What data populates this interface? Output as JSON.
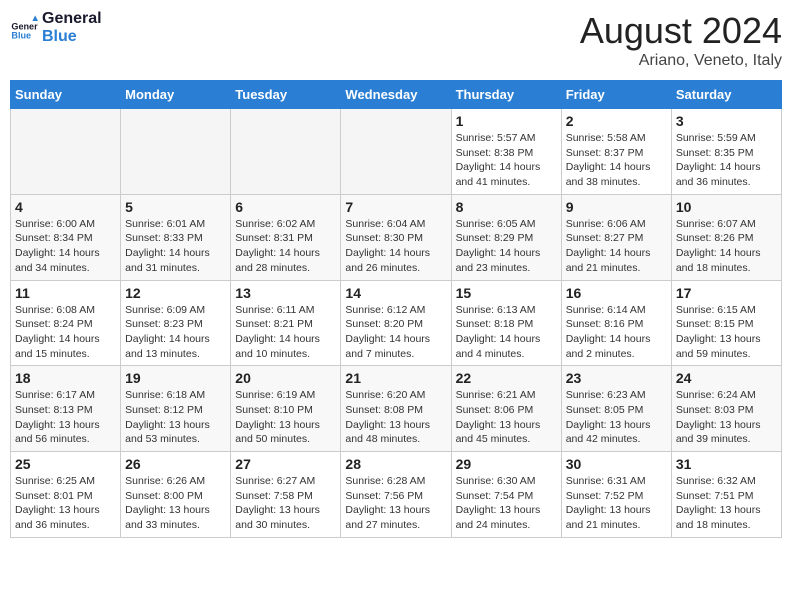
{
  "logo": {
    "line1": "General",
    "line2": "Blue"
  },
  "title": "August 2024",
  "location": "Ariano, Veneto, Italy",
  "weekdays": [
    "Sunday",
    "Monday",
    "Tuesday",
    "Wednesday",
    "Thursday",
    "Friday",
    "Saturday"
  ],
  "weeks": [
    [
      {
        "day": "",
        "empty": true
      },
      {
        "day": "",
        "empty": true
      },
      {
        "day": "",
        "empty": true
      },
      {
        "day": "",
        "empty": true
      },
      {
        "day": "1",
        "sunrise": "5:57 AM",
        "sunset": "8:38 PM",
        "daylight": "14 hours and 41 minutes."
      },
      {
        "day": "2",
        "sunrise": "5:58 AM",
        "sunset": "8:37 PM",
        "daylight": "14 hours and 38 minutes."
      },
      {
        "day": "3",
        "sunrise": "5:59 AM",
        "sunset": "8:35 PM",
        "daylight": "14 hours and 36 minutes."
      }
    ],
    [
      {
        "day": "4",
        "sunrise": "6:00 AM",
        "sunset": "8:34 PM",
        "daylight": "14 hours and 34 minutes."
      },
      {
        "day": "5",
        "sunrise": "6:01 AM",
        "sunset": "8:33 PM",
        "daylight": "14 hours and 31 minutes."
      },
      {
        "day": "6",
        "sunrise": "6:02 AM",
        "sunset": "8:31 PM",
        "daylight": "14 hours and 28 minutes."
      },
      {
        "day": "7",
        "sunrise": "6:04 AM",
        "sunset": "8:30 PM",
        "daylight": "14 hours and 26 minutes."
      },
      {
        "day": "8",
        "sunrise": "6:05 AM",
        "sunset": "8:29 PM",
        "daylight": "14 hours and 23 minutes."
      },
      {
        "day": "9",
        "sunrise": "6:06 AM",
        "sunset": "8:27 PM",
        "daylight": "14 hours and 21 minutes."
      },
      {
        "day": "10",
        "sunrise": "6:07 AM",
        "sunset": "8:26 PM",
        "daylight": "14 hours and 18 minutes."
      }
    ],
    [
      {
        "day": "11",
        "sunrise": "6:08 AM",
        "sunset": "8:24 PM",
        "daylight": "14 hours and 15 minutes."
      },
      {
        "day": "12",
        "sunrise": "6:09 AM",
        "sunset": "8:23 PM",
        "daylight": "14 hours and 13 minutes."
      },
      {
        "day": "13",
        "sunrise": "6:11 AM",
        "sunset": "8:21 PM",
        "daylight": "14 hours and 10 minutes."
      },
      {
        "day": "14",
        "sunrise": "6:12 AM",
        "sunset": "8:20 PM",
        "daylight": "14 hours and 7 minutes."
      },
      {
        "day": "15",
        "sunrise": "6:13 AM",
        "sunset": "8:18 PM",
        "daylight": "14 hours and 4 minutes."
      },
      {
        "day": "16",
        "sunrise": "6:14 AM",
        "sunset": "8:16 PM",
        "daylight": "14 hours and 2 minutes."
      },
      {
        "day": "17",
        "sunrise": "6:15 AM",
        "sunset": "8:15 PM",
        "daylight": "13 hours and 59 minutes."
      }
    ],
    [
      {
        "day": "18",
        "sunrise": "6:17 AM",
        "sunset": "8:13 PM",
        "daylight": "13 hours and 56 minutes."
      },
      {
        "day": "19",
        "sunrise": "6:18 AM",
        "sunset": "8:12 PM",
        "daylight": "13 hours and 53 minutes."
      },
      {
        "day": "20",
        "sunrise": "6:19 AM",
        "sunset": "8:10 PM",
        "daylight": "13 hours and 50 minutes."
      },
      {
        "day": "21",
        "sunrise": "6:20 AM",
        "sunset": "8:08 PM",
        "daylight": "13 hours and 48 minutes."
      },
      {
        "day": "22",
        "sunrise": "6:21 AM",
        "sunset": "8:06 PM",
        "daylight": "13 hours and 45 minutes."
      },
      {
        "day": "23",
        "sunrise": "6:23 AM",
        "sunset": "8:05 PM",
        "daylight": "13 hours and 42 minutes."
      },
      {
        "day": "24",
        "sunrise": "6:24 AM",
        "sunset": "8:03 PM",
        "daylight": "13 hours and 39 minutes."
      }
    ],
    [
      {
        "day": "25",
        "sunrise": "6:25 AM",
        "sunset": "8:01 PM",
        "daylight": "13 hours and 36 minutes."
      },
      {
        "day": "26",
        "sunrise": "6:26 AM",
        "sunset": "8:00 PM",
        "daylight": "13 hours and 33 minutes."
      },
      {
        "day": "27",
        "sunrise": "6:27 AM",
        "sunset": "7:58 PM",
        "daylight": "13 hours and 30 minutes."
      },
      {
        "day": "28",
        "sunrise": "6:28 AM",
        "sunset": "7:56 PM",
        "daylight": "13 hours and 27 minutes."
      },
      {
        "day": "29",
        "sunrise": "6:30 AM",
        "sunset": "7:54 PM",
        "daylight": "13 hours and 24 minutes."
      },
      {
        "day": "30",
        "sunrise": "6:31 AM",
        "sunset": "7:52 PM",
        "daylight": "13 hours and 21 minutes."
      },
      {
        "day": "31",
        "sunrise": "6:32 AM",
        "sunset": "7:51 PM",
        "daylight": "13 hours and 18 minutes."
      }
    ]
  ]
}
